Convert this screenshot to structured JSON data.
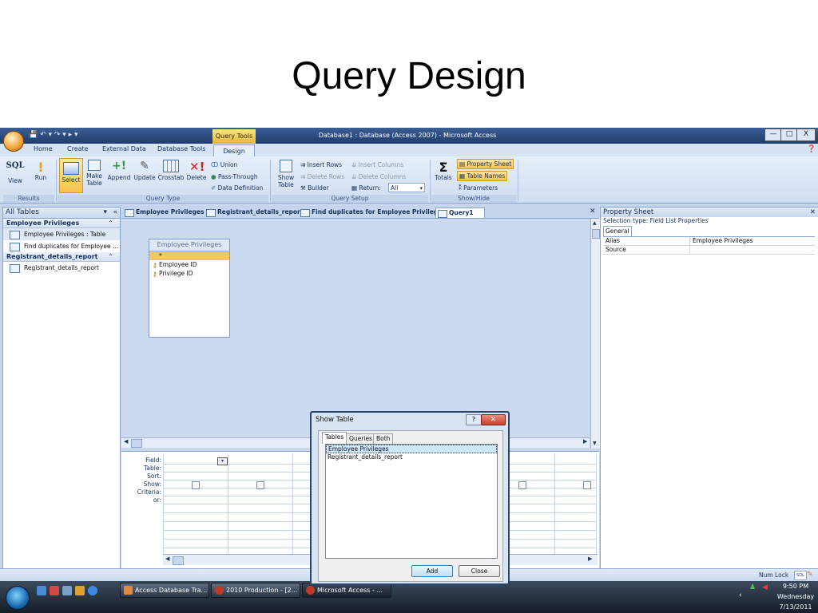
{
  "slide": {
    "title": "Query Design"
  },
  "window": {
    "title": "Database1 : Database (Access 2007) - Microsoft Access",
    "contextual_tab": "Query Tools",
    "controls": {
      "minimize": "—",
      "maximize": "□",
      "close": "X"
    }
  },
  "ribbon": {
    "tabs": [
      "Home",
      "Create",
      "External Data",
      "Database Tools",
      "Design"
    ],
    "active_tab": "Design",
    "results": {
      "label": "Results",
      "sql": "SQL",
      "view": "View",
      "run": "Run"
    },
    "query_type": {
      "label": "Query Type",
      "select": "Select",
      "make_table": "Make\nTable",
      "append": "Append",
      "update": "Update",
      "crosstab": "Crosstab",
      "delete": "Delete",
      "union": "Union",
      "pass_through": "Pass-Through",
      "data_definition": "Data Definition"
    },
    "query_setup": {
      "label": "Query Setup",
      "show_table": "Show\nTable",
      "insert_rows": "Insert Rows",
      "delete_rows": "Delete Rows",
      "builder": "Builder",
      "insert_columns": "Insert Columns",
      "delete_columns": "Delete Columns",
      "return_label": "Return:",
      "return_value": "All"
    },
    "show_hide": {
      "label": "Show/Hide",
      "totals": "Totals",
      "property_sheet": "Property Sheet",
      "table_names": "Table Names",
      "parameters": "Parameters"
    }
  },
  "nav": {
    "header": "All Tables",
    "groups": [
      {
        "name": "Employee Privileges",
        "items": [
          "Employee Privileges : Table",
          "Find duplicates for Employee ..."
        ]
      },
      {
        "name": "Registrant_details_report",
        "items": [
          "Registrant_details_report"
        ]
      }
    ]
  },
  "doc_tabs": [
    "Employee Privileges",
    "Registrant_details_report",
    "Find duplicates for Employee Privileges",
    "Query1"
  ],
  "field_list": {
    "title": "Employee Privileges",
    "fields": [
      "*",
      "Employee ID",
      "Privilege ID"
    ]
  },
  "grid": {
    "row_labels": [
      "Field:",
      "Table:",
      "Sort:",
      "Show:",
      "Criteria:",
      "or:"
    ]
  },
  "property_sheet": {
    "title": "Property Sheet",
    "selection_type": "Selection type:  Field List Properties",
    "tab": "General",
    "rows": [
      {
        "name": "Alias",
        "value": "Employee Privileges"
      },
      {
        "name": "Source",
        "value": ""
      }
    ]
  },
  "show_table": {
    "title": "Show Table",
    "tabs": [
      "Tables",
      "Queries",
      "Both"
    ],
    "items": [
      "Employee Privileges",
      "Registrant_details_report"
    ],
    "add": "Add",
    "close": "Close",
    "help": "?"
  },
  "status": {
    "numlock": "Num Lock",
    "sql_badge": "SQL"
  },
  "taskbar": {
    "buttons": [
      "Access Database Tra...",
      "2010 Production - [2...",
      "Microsoft Access - ..."
    ],
    "time": "9:50 PM",
    "day": "Wednesday",
    "date": "7/13/2011"
  }
}
